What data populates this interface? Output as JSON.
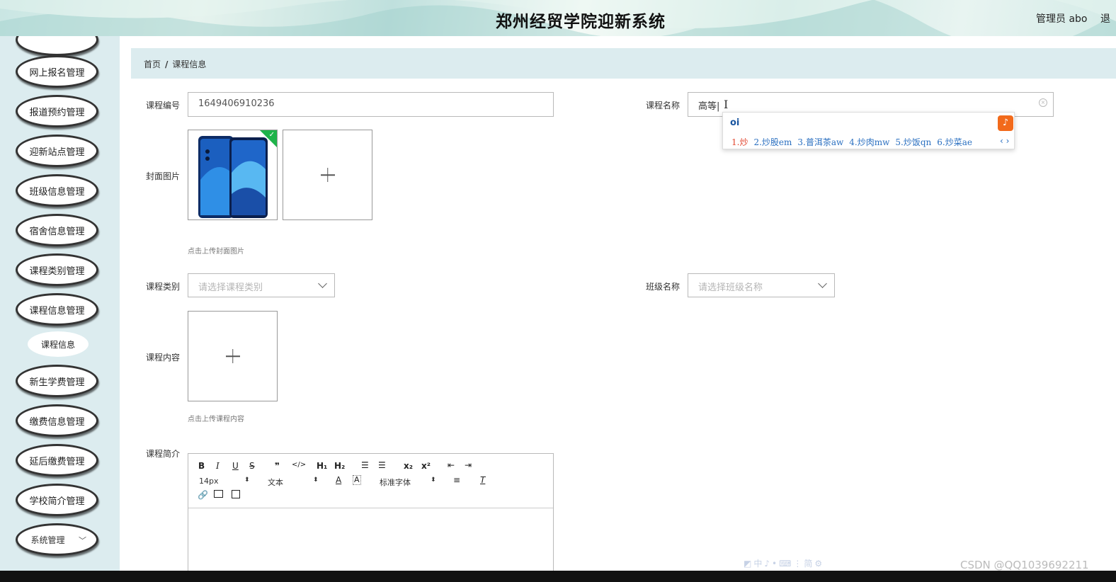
{
  "header": {
    "title": "郑州经贸学院迎新系统",
    "user_label": "管理员 abo",
    "logout_label": "退"
  },
  "sidebar": {
    "items": [
      {
        "label": "网上报名管理"
      },
      {
        "label": "报道预约管理"
      },
      {
        "label": "迎新站点管理"
      },
      {
        "label": "班级信息管理"
      },
      {
        "label": "宿舍信息管理"
      },
      {
        "label": "课程类别管理"
      },
      {
        "label": "课程信息管理"
      },
      {
        "label": "新生学费管理"
      },
      {
        "label": "缴费信息管理"
      },
      {
        "label": "延后缴费管理"
      },
      {
        "label": "学校简介管理"
      },
      {
        "label": "系统管理"
      }
    ],
    "active_sub_item": "课程信息"
  },
  "breadcrumb": {
    "home": "首页",
    "separator": "/",
    "current": "课程信息"
  },
  "form": {
    "course_no_label": "课程编号",
    "course_no_value": "1649406910236",
    "course_name_label": "课程名称",
    "course_name_value": "高等",
    "cover_label": "封面图片",
    "cover_hint": "点击上传封面图片",
    "category_label": "课程类别",
    "category_placeholder": "请选择课程类别",
    "class_label": "班级名称",
    "class_placeholder": "请选择班级名称",
    "content_label": "课程内容",
    "content_hint": "点击上传课程内容",
    "intro_label": "课程简介"
  },
  "ime": {
    "composition": "oi",
    "candidates": [
      "1.炒",
      "2.炒股em",
      "3.普洱茶aw",
      "4.炒肉mw",
      "5.炒饭qn",
      "6.炒菜ae"
    ],
    "nav": "‹ ›"
  },
  "editor": {
    "font_size": "14px",
    "paragraph": "文本",
    "font_family": "标准字体"
  },
  "watermark": "CSDN @QQ1039692211",
  "colors": {
    "sidebar_bg": "#dcecef",
    "breadcrumb_bg": "#dcecef",
    "check_badge": "#1fb34a",
    "ime_logo": "#f26a1b"
  }
}
